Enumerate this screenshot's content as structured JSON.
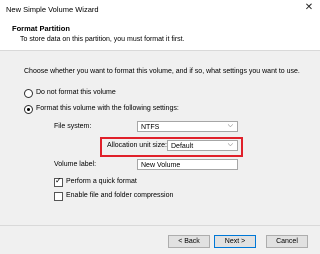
{
  "window": {
    "title": "New Simple Volume Wizard",
    "close_icon": "close-icon"
  },
  "header": {
    "title": "Format Partition",
    "subtitle": "To store data on this partition, you must format it first."
  },
  "body": {
    "prompt": "Choose whether you want to format this volume, and if so, what settings you want to use.",
    "options": [
      {
        "label": "Do not format this volume",
        "selected": false
      },
      {
        "label": "Format this volume with the following settings:",
        "selected": true
      }
    ],
    "file_system": {
      "label": "File system:",
      "value": "NTFS"
    },
    "allocation": {
      "label": "Allocation unit size:",
      "value": "Default"
    },
    "volume_label": {
      "label": "Volume label:",
      "value": "New Volume"
    },
    "quick_format": {
      "label": "Perform a quick format",
      "checked": true
    },
    "compression": {
      "label": "Enable file and folder compression",
      "checked": false
    }
  },
  "footer": {
    "back": "< Back",
    "next": "Next >",
    "cancel": "Cancel"
  },
  "colors": {
    "highlight": "#e0202a",
    "accent": "#0078d7"
  }
}
